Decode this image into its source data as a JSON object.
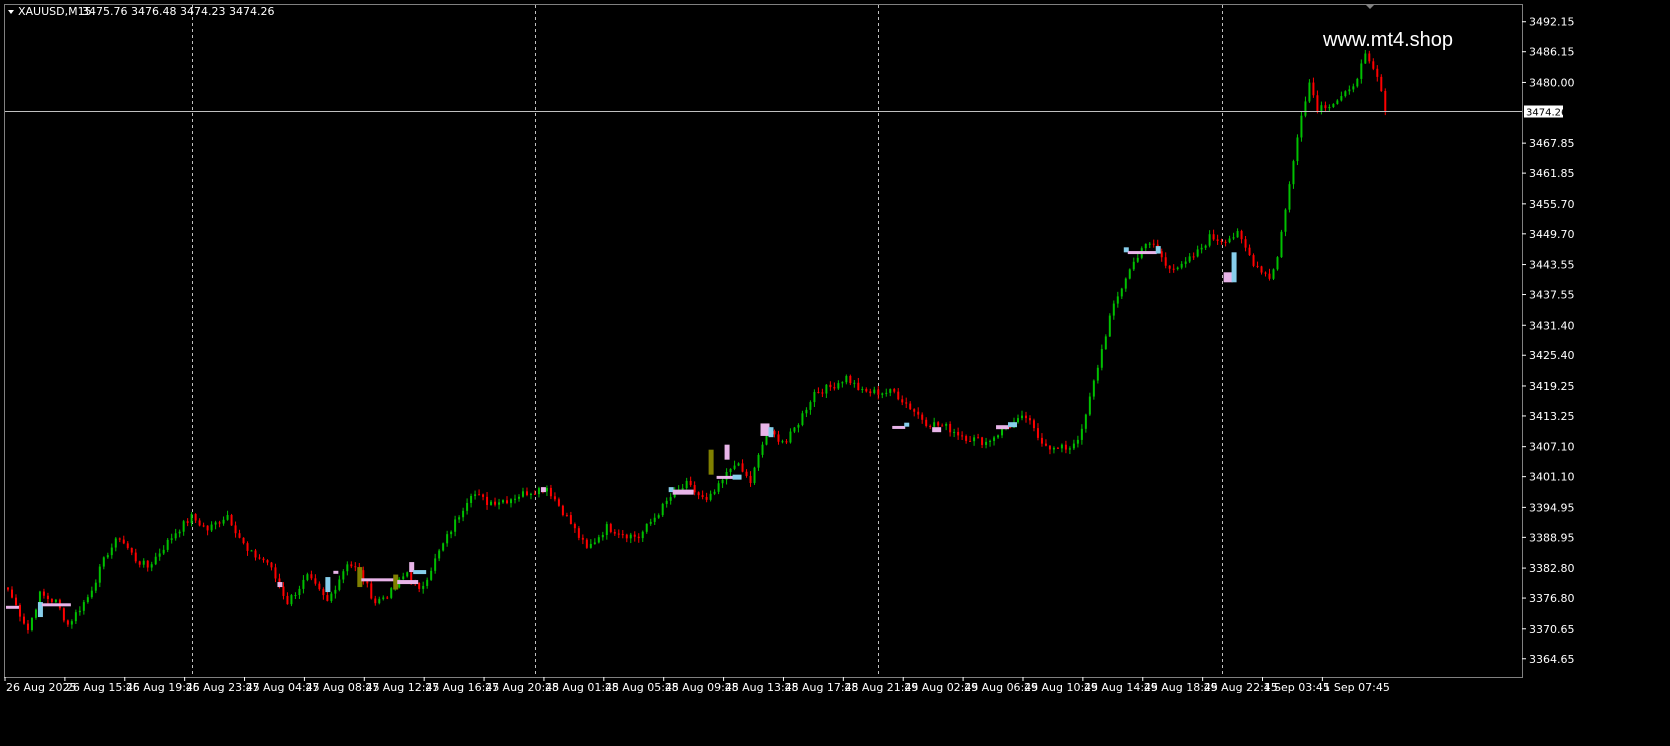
{
  "header": {
    "symbol": "XAUUSD,M15",
    "quote": "3475.76 3476.48 3474.23 3474.26"
  },
  "watermark": "www.mt4.shop",
  "colors": {
    "background": "#000000",
    "bull": "#00c000",
    "bear": "#ff0000",
    "grid": "#c0c0c0",
    "text": "#ffffff",
    "marker_pink": "#e8b4e8",
    "marker_blue": "#87ceeb",
    "marker_olive": "#808000"
  },
  "chart_data": {
    "type": "candlestick",
    "symbol": "XAUUSD",
    "timeframe": "M15",
    "last_price": 3474.26,
    "last_price_label": "3474.26",
    "ylim": [
      3361.0,
      3495.5
    ],
    "grid": "vertical dashed separators",
    "y_ticks": [
      "3492.15",
      "3486.15",
      "3480.00",
      "3474.26",
      "3467.85",
      "3461.85",
      "3455.70",
      "3449.70",
      "3443.55",
      "3437.55",
      "3431.40",
      "3425.40",
      "3419.25",
      "3413.25",
      "3407.10",
      "3401.10",
      "3394.95",
      "3388.95",
      "3382.80",
      "3376.80",
      "3370.65",
      "3364.65"
    ],
    "x_labels": [
      "26 Aug 2025",
      "26 Aug 15:45",
      "26 Aug 19:45",
      "26 Aug 23:45",
      "27 Aug 04:45",
      "27 Aug 08:45",
      "27 Aug 12:45",
      "27 Aug 16:45",
      "27 Aug 20:45",
      "28 Aug 01:45",
      "28 Aug 05:45",
      "28 Aug 09:45",
      "28 Aug 13:45",
      "28 Aug 17:45",
      "28 Aug 21:45",
      "29 Aug 02:45",
      "29 Aug 06:45",
      "29 Aug 10:45",
      "29 Aug 14:45",
      "29 Aug 18:45",
      "29 Aug 22:45",
      "1 Sep 03:45",
      "1 Sep 07:45"
    ],
    "x_label_bar": [
      0,
      15,
      30,
      45,
      60,
      75,
      90,
      105,
      120,
      135,
      150,
      165,
      180,
      195,
      210,
      225,
      240,
      255,
      270,
      285,
      300,
      315,
      330
    ],
    "total_bars": 380,
    "day_separator_bars": [
      46,
      132,
      218,
      304
    ],
    "price_path": [
      [
        0,
        3378.5
      ],
      [
        5,
        3370.5
      ],
      [
        8,
        3377.5
      ],
      [
        12,
        3376
      ],
      [
        15,
        3371.5
      ],
      [
        20,
        3377
      ],
      [
        25,
        3386
      ],
      [
        28,
        3389
      ],
      [
        32,
        3384.5
      ],
      [
        35,
        3383
      ],
      [
        38,
        3386
      ],
      [
        42,
        3390
      ],
      [
        46,
        3393
      ],
      [
        50,
        3390.5
      ],
      [
        55,
        3393.5
      ],
      [
        60,
        3386
      ],
      [
        65,
        3384
      ],
      [
        70,
        3376
      ],
      [
        75,
        3381
      ],
      [
        80,
        3376
      ],
      [
        85,
        3384
      ],
      [
        88,
        3382
      ],
      [
        92,
        3376
      ],
      [
        96,
        3378
      ],
      [
        100,
        3382
      ],
      [
        103,
        3378
      ],
      [
        108,
        3386
      ],
      [
        112,
        3392
      ],
      [
        116,
        3398
      ],
      [
        120,
        3396
      ],
      [
        125,
        3396.5
      ],
      [
        130,
        3398
      ],
      [
        135,
        3399
      ],
      [
        140,
        3393
      ],
      [
        145,
        3386.5
      ],
      [
        150,
        3391
      ],
      [
        155,
        3389.5
      ],
      [
        158,
        3389
      ],
      [
        162,
        3393
      ],
      [
        166,
        3397
      ],
      [
        170,
        3399.5
      ],
      [
        175,
        3396
      ],
      [
        178,
        3399
      ],
      [
        182,
        3404
      ],
      [
        186,
        3400
      ],
      [
        190,
        3410
      ],
      [
        195,
        3408
      ],
      [
        198,
        3412
      ],
      [
        202,
        3418
      ],
      [
        206,
        3419
      ],
      [
        210,
        3421
      ],
      [
        214,
        3418
      ],
      [
        218,
        3418
      ],
      [
        222,
        3418
      ],
      [
        226,
        3415
      ],
      [
        230,
        3412
      ],
      [
        235,
        3411
      ],
      [
        240,
        3409
      ],
      [
        245,
        3408
      ],
      [
        250,
        3411
      ],
      [
        255,
        3413
      ],
      [
        258,
        3409
      ],
      [
        262,
        3406.5
      ],
      [
        266,
        3407
      ],
      [
        269,
        3410
      ],
      [
        272,
        3420
      ],
      [
        276,
        3433
      ],
      [
        280,
        3441
      ],
      [
        284,
        3447
      ],
      [
        287,
        3447.5
      ],
      [
        290,
        3443.5
      ],
      [
        294,
        3443
      ],
      [
        298,
        3446
      ],
      [
        301,
        3449
      ],
      [
        304,
        3448.5
      ],
      [
        308,
        3449.5
      ],
      [
        312,
        3444
      ],
      [
        316,
        3441
      ],
      [
        318,
        3445
      ],
      [
        320,
        3455
      ],
      [
        322,
        3464
      ],
      [
        324,
        3474
      ],
      [
        326,
        3480
      ],
      [
        328,
        3475
      ],
      [
        332,
        3476
      ],
      [
        336,
        3478
      ],
      [
        340,
        3485
      ],
      [
        343,
        3481
      ],
      [
        345,
        3474.26
      ]
    ],
    "markers": [
      {
        "bar": 0,
        "w": 3,
        "price": 3375,
        "h": 0.5,
        "color": "pink"
      },
      {
        "bar": 8,
        "w": 1,
        "price": 3374.5,
        "h": 3,
        "color": "blue"
      },
      {
        "bar": 9,
        "w": 7,
        "price": 3375.5,
        "h": 0.5,
        "color": "pink"
      },
      {
        "bar": 68,
        "w": 1,
        "price": 3379.5,
        "h": 1,
        "color": "pink"
      },
      {
        "bar": 80,
        "w": 1,
        "price": 3379.5,
        "h": 3,
        "color": "blue"
      },
      {
        "bar": 82,
        "w": 1,
        "price": 3382,
        "h": 0.5,
        "color": "pink"
      },
      {
        "bar": 88,
        "w": 1,
        "price": 3381,
        "h": 4,
        "color": "olive"
      },
      {
        "bar": 89,
        "w": 8,
        "price": 3380.5,
        "h": 0.5,
        "color": "pink"
      },
      {
        "bar": 97,
        "w": 1,
        "price": 3380,
        "h": 3,
        "color": "olive"
      },
      {
        "bar": 98,
        "w": 5,
        "price": 3380,
        "h": 0.8,
        "color": "pink"
      },
      {
        "bar": 101,
        "w": 1,
        "price": 3383,
        "h": 2,
        "color": "pink"
      },
      {
        "bar": 102,
        "w": 3,
        "price": 3382,
        "h": 0.8,
        "color": "blue"
      },
      {
        "bar": 134,
        "w": 1,
        "price": 3398.5,
        "h": 1,
        "color": "pink"
      },
      {
        "bar": 166,
        "w": 1,
        "price": 3398.5,
        "h": 1,
        "color": "blue"
      },
      {
        "bar": 167,
        "w": 5,
        "price": 3398,
        "h": 1,
        "color": "pink"
      },
      {
        "bar": 176,
        "w": 1,
        "price": 3404,
        "h": 5,
        "color": "olive"
      },
      {
        "bar": 178,
        "w": 4,
        "price": 3401,
        "h": 0.5,
        "color": "pink"
      },
      {
        "bar": 180,
        "w": 1,
        "price": 3406,
        "h": 3,
        "color": "pink"
      },
      {
        "bar": 182,
        "w": 2,
        "price": 3401,
        "h": 1,
        "color": "blue"
      },
      {
        "bar": 189,
        "w": 2,
        "price": 3410.5,
        "h": 2.5,
        "color": "pink"
      },
      {
        "bar": 191,
        "w": 1,
        "price": 3410,
        "h": 2,
        "color": "blue"
      },
      {
        "bar": 222,
        "w": 3,
        "price": 3411,
        "h": 0.5,
        "color": "pink"
      },
      {
        "bar": 225,
        "w": 1,
        "price": 3411.5,
        "h": 0.8,
        "color": "blue"
      },
      {
        "bar": 232,
        "w": 2,
        "price": 3410.5,
        "h": 1,
        "color": "pink"
      },
      {
        "bar": 248,
        "w": 3,
        "price": 3411,
        "h": 0.8,
        "color": "pink"
      },
      {
        "bar": 251,
        "w": 2,
        "price": 3411.5,
        "h": 1,
        "color": "blue"
      },
      {
        "bar": 280,
        "w": 1,
        "price": 3446.5,
        "h": 1,
        "color": "blue"
      },
      {
        "bar": 281,
        "w": 7,
        "price": 3446,
        "h": 0.5,
        "color": "pink"
      },
      {
        "bar": 288,
        "w": 1,
        "price": 3446.5,
        "h": 1.5,
        "color": "blue"
      },
      {
        "bar": 305,
        "w": 2,
        "price": 3441,
        "h": 2,
        "color": "pink"
      },
      {
        "bar": 307,
        "w": 1,
        "price": 3443,
        "h": 6,
        "color": "blue"
      }
    ]
  }
}
